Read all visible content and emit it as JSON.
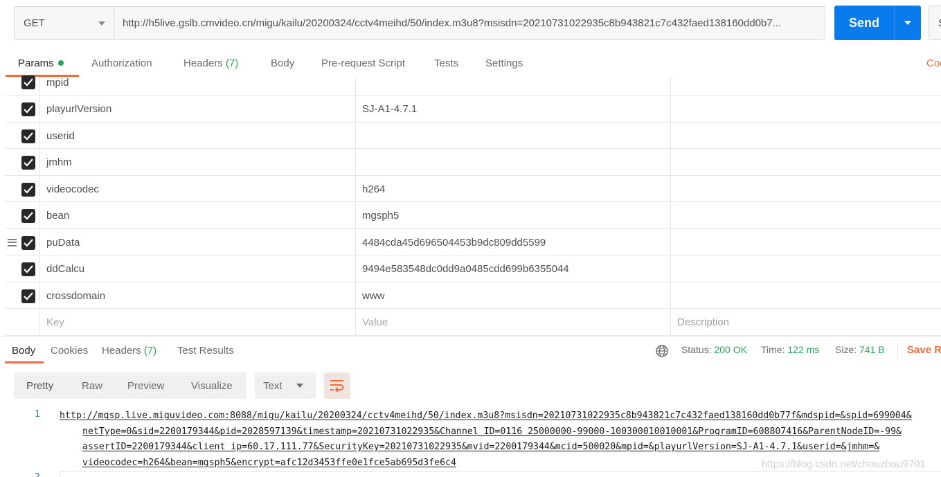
{
  "request": {
    "method": "GET",
    "url": "http://h5live.gslb.cmvideo.cn/migu/kailu/20200324/cctv4meihd/50/index.m3u8?msisdn=20210731022935c8b943821c7c432faed138160dd0b7...",
    "send_label": "Send",
    "save_label": "S"
  },
  "request_tabs": {
    "params": "Params",
    "authorization": "Authorization",
    "headers": "Headers",
    "headers_count": "(7)",
    "body": "Body",
    "prerequest": "Pre-request Script",
    "tests": "Tests",
    "settings": "Settings",
    "cookies": "Coo"
  },
  "params": [
    {
      "key": "mpid",
      "value": ""
    },
    {
      "key": "playurlVersion",
      "value": "SJ-A1-4.7.1"
    },
    {
      "key": "userid",
      "value": ""
    },
    {
      "key": "jmhm",
      "value": ""
    },
    {
      "key": "videocodec",
      "value": "h264"
    },
    {
      "key": "bean",
      "value": "mgsph5"
    },
    {
      "key": "puData",
      "value": "4484cda45d696504453b9dc809dd5599"
    },
    {
      "key": "ddCalcu",
      "value": "9494e583548dc0dd9a0485cdd699b6355044"
    },
    {
      "key": "crossdomain",
      "value": "www"
    }
  ],
  "params_placeholder": {
    "key": "Key",
    "value": "Value",
    "description": "Description"
  },
  "response_tabs": {
    "body": "Body",
    "cookies": "Cookies",
    "headers": "Headers",
    "headers_count": "(7)",
    "test_results": "Test Results"
  },
  "response_status": {
    "status_label": "Status:",
    "status_value": "200 OK",
    "time_label": "Time:",
    "time_value": "122 ms",
    "size_label": "Size:",
    "size_value": "741 B",
    "save_response": "Save Re"
  },
  "format_bar": {
    "pretty": "Pretty",
    "raw": "Raw",
    "preview": "Preview",
    "visualize": "Visualize",
    "text_select": "Text"
  },
  "code": {
    "line_numbers": [
      "1",
      "2"
    ],
    "lines": [
      "http://mgsp.live.miguvideo.com:8088/migu/kailu/20200324/cctv4meihd/50/index.m3u8?msisdn=20210731022935c8b943821c7c432faed138160dd0b77f&mdspid=&spid=699004&",
      "netType=0&sid=2200179344&pid=2028597139&timestamp=20210731022935&Channel_ID=0116_25000000-99000-100300010010001&ProgramID=608807416&ParentNodeID=-99&",
      "assertID=2200179344&client_ip=60.17.111.77&SecurityKey=20210731022935&mvid=2200179344&mcid=500020&mpid=&playurlVersion=SJ-A1-4.7.1&userid=&jmhm=&",
      "videocodec=h264&bean=mgsph5&encrypt=afc12d3453ffe0e1fce5ab695d3fe6c4"
    ]
  },
  "watermark": "https://blog.csdn.net/chouzhou9701"
}
